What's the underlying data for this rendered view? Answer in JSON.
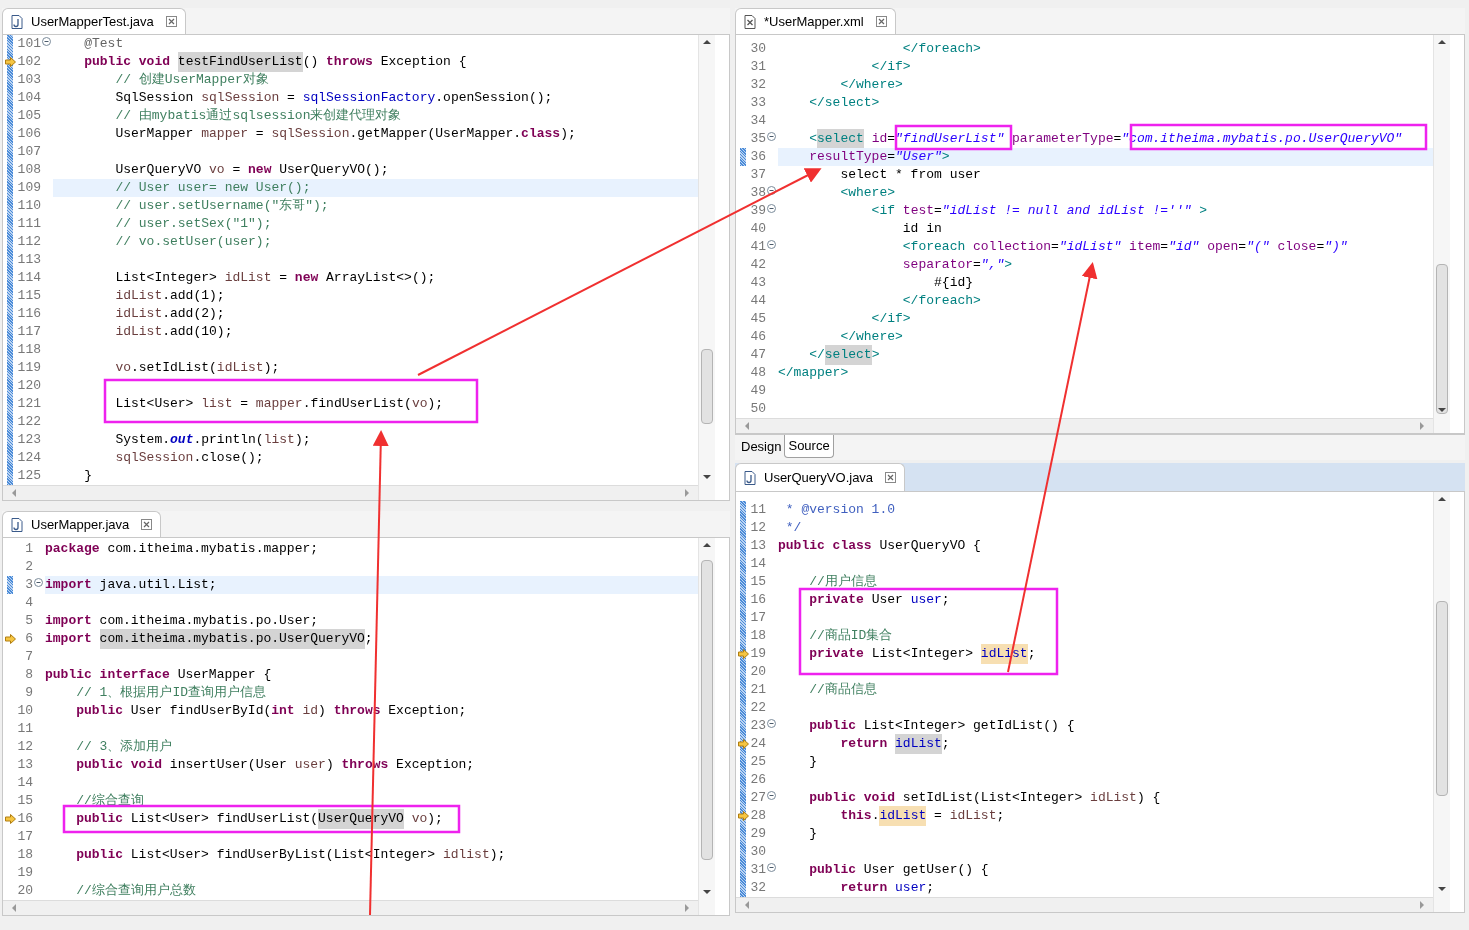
{
  "panes": [
    {
      "tab": {
        "title": "UserMapperTest.java",
        "kind": "java"
      },
      "ruler": true,
      "lines": [
        {
          "n": "101",
          "kind": "fold",
          "current": false,
          "spans": [
            {
              "text": "    @Test",
              "kind": "ann"
            }
          ]
        },
        {
          "n": "102",
          "kind": "arrow",
          "current": false,
          "spans": [
            {
              "text": "    public void ",
              "kind": "kw"
            },
            {
              "text": "testFindUserList",
              "kind": "occ"
            },
            {
              "text": "() ",
              "kind": "p"
            },
            {
              "text": "throws",
              "kind": "kw"
            },
            {
              "text": " Exception {",
              "kind": "p"
            }
          ]
        },
        {
          "n": "103",
          "kind": "plain",
          "current": false,
          "spans": [
            {
              "text": "        // 创建UserMapper对象",
              "kind": "cm"
            }
          ]
        },
        {
          "n": "104",
          "kind": "plain",
          "current": false,
          "spans": [
            {
              "text": "        SqlSession ",
              "kind": "p"
            },
            {
              "text": "sqlSession",
              "kind": "var"
            },
            {
              "text": " = ",
              "kind": "p"
            },
            {
              "text": "sqlSessionFactory",
              "kind": "fld"
            },
            {
              "text": ".openSession();",
              "kind": "p"
            }
          ]
        },
        {
          "n": "105",
          "kind": "plain",
          "current": false,
          "spans": [
            {
              "text": "        // 由mybatis通过sqlsession来创建代理对象",
              "kind": "cm"
            }
          ]
        },
        {
          "n": "106",
          "kind": "plain",
          "current": false,
          "spans": [
            {
              "text": "        UserMapper ",
              "kind": "p"
            },
            {
              "text": "mapper",
              "kind": "var"
            },
            {
              "text": " = ",
              "kind": "p"
            },
            {
              "text": "sqlSession",
              "kind": "var"
            },
            {
              "text": ".getMapper(UserMapper.",
              "kind": "p"
            },
            {
              "text": "class",
              "kind": "kw"
            },
            {
              "text": ");",
              "kind": "p"
            }
          ]
        },
        {
          "n": "107",
          "kind": "plain",
          "current": false
        },
        {
          "n": "108",
          "kind": "plain",
          "current": false,
          "spans": [
            {
              "text": "        UserQueryVO ",
              "kind": "p"
            },
            {
              "text": "vo",
              "kind": "var"
            },
            {
              "text": " = ",
              "kind": "p"
            },
            {
              "text": "new",
              "kind": "kw"
            },
            {
              "text": " UserQueryVO();",
              "kind": "p"
            }
          ]
        },
        {
          "n": "109",
          "kind": "plain",
          "current": true,
          "spans": [
            {
              "text": "        // User user= new User();",
              "kind": "cm"
            }
          ]
        },
        {
          "n": "110",
          "kind": "plain",
          "current": false,
          "spans": [
            {
              "text": "        // user.setUsername(\"东哥\");",
              "kind": "cm"
            }
          ]
        },
        {
          "n": "111",
          "kind": "plain",
          "current": false,
          "spans": [
            {
              "text": "        // user.setSex(\"1\");",
              "kind": "cm"
            }
          ]
        },
        {
          "n": "112",
          "kind": "plain",
          "current": false,
          "spans": [
            {
              "text": "        // vo.setUser(user);",
              "kind": "cm"
            }
          ]
        },
        {
          "n": "113",
          "kind": "plain",
          "current": false
        },
        {
          "n": "114",
          "kind": "plain",
          "current": false,
          "spans": [
            {
              "text": "        List<Integer> ",
              "kind": "p"
            },
            {
              "text": "idList",
              "kind": "var"
            },
            {
              "text": " = ",
              "kind": "p"
            },
            {
              "text": "new",
              "kind": "kw"
            },
            {
              "text": " ArrayList<>();",
              "kind": "p"
            }
          ]
        },
        {
          "n": "115",
          "kind": "plain",
          "current": false,
          "spans": [
            {
              "text": "        idList",
              "kind": "var"
            },
            {
              "text": ".add(1);",
              "kind": "p"
            }
          ]
        },
        {
          "n": "116",
          "kind": "plain",
          "current": false,
          "spans": [
            {
              "text": "        idList",
              "kind": "var"
            },
            {
              "text": ".add(2);",
              "kind": "p"
            }
          ]
        },
        {
          "n": "117",
          "kind": "plain",
          "current": false,
          "spans": [
            {
              "text": "        idList",
              "kind": "var"
            },
            {
              "text": ".add(10);",
              "kind": "p"
            }
          ]
        },
        {
          "n": "118",
          "kind": "plain",
          "current": false
        },
        {
          "n": "119",
          "kind": "plain",
          "current": false,
          "spans": [
            {
              "text": "        vo",
              "kind": "var"
            },
            {
              "text": ".setIdList(",
              "kind": "p"
            },
            {
              "text": "idList",
              "kind": "var"
            },
            {
              "text": ");",
              "kind": "p"
            }
          ]
        },
        {
          "n": "120",
          "kind": "plain",
          "current": false
        },
        {
          "n": "121",
          "kind": "plain",
          "current": false,
          "spans": [
            {
              "text": "        List<User> ",
              "kind": "p"
            },
            {
              "text": "list",
              "kind": "var"
            },
            {
              "text": " = ",
              "kind": "p"
            },
            {
              "text": "mapper",
              "kind": "var"
            },
            {
              "text": ".findUserList(",
              "kind": "p"
            },
            {
              "text": "vo",
              "kind": "var"
            },
            {
              "text": ");",
              "kind": "p"
            }
          ]
        },
        {
          "n": "122",
          "kind": "plain",
          "current": false
        },
        {
          "n": "123",
          "kind": "plain",
          "current": false,
          "spans": [
            {
              "text": "        System.",
              "kind": "p"
            },
            {
              "text": "out",
              "kind": "sfld"
            },
            {
              "text": ".println(",
              "kind": "p"
            },
            {
              "text": "list",
              "kind": "var"
            },
            {
              "text": ");",
              "kind": "p"
            }
          ]
        },
        {
          "n": "124",
          "kind": "plain",
          "current": false,
          "spans": [
            {
              "text": "        sqlSession",
              "kind": "var"
            },
            {
              "text": ".close();",
              "kind": "p"
            }
          ]
        },
        {
          "n": "125",
          "kind": "plain",
          "current": false,
          "spans": [
            {
              "text": "    }",
              "kind": "p"
            }
          ]
        }
      ]
    },
    {
      "tab": {
        "title": "*UserMapper.xml",
        "kind": "xml"
      },
      "ruler": false,
      "lines": [
        {
          "n": "30",
          "kind": "plain",
          "current": false,
          "spans": [
            {
              "text": "                </foreach>",
              "kind": "tag"
            }
          ]
        },
        {
          "n": "31",
          "kind": "plain",
          "current": false,
          "spans": [
            {
              "text": "            </if>",
              "kind": "tag"
            }
          ]
        },
        {
          "n": "32",
          "kind": "plain",
          "current": false,
          "spans": [
            {
              "text": "        </where>",
              "kind": "tag"
            }
          ]
        },
        {
          "n": "33",
          "kind": "plain",
          "current": false,
          "spans": [
            {
              "text": "    </select>",
              "kind": "tag"
            }
          ]
        },
        {
          "n": "34",
          "kind": "plain",
          "current": false
        },
        {
          "n": "35",
          "kind": "fold",
          "current": false,
          "spans": [
            {
              "text": "    <",
              "kind": "tag"
            },
            {
              "text": "select",
              "kind": "tagocc"
            },
            {
              "text": " id",
              "kind": "attr"
            },
            {
              "text": "=",
              "kind": "p"
            },
            {
              "text": "\"findUserList\"",
              "kind": "str"
            },
            {
              "text": " parameterType",
              "kind": "attr"
            },
            {
              "text": "=",
              "kind": "p"
            },
            {
              "text": "\"com.itheima.mybatis.po.UserQueryVO\"",
              "kind": "str"
            }
          ]
        },
        {
          "n": "36",
          "kind": "plain",
          "current": true,
          "spans": [
            {
              "text": "    resultType",
              "kind": "attr"
            },
            {
              "text": "=",
              "kind": "p"
            },
            {
              "text": "\"User\"",
              "kind": "str"
            },
            {
              "text": ">",
              "kind": "tag"
            }
          ]
        },
        {
          "n": "37",
          "kind": "plain",
          "current": false,
          "spans": [
            {
              "text": "        select * from user",
              "kind": "p"
            }
          ]
        },
        {
          "n": "38",
          "kind": "fold",
          "current": false,
          "spans": [
            {
              "text": "        <where>",
              "kind": "tag"
            }
          ]
        },
        {
          "n": "39",
          "kind": "fold",
          "current": false,
          "spans": [
            {
              "text": "            <if ",
              "kind": "tag"
            },
            {
              "text": "test",
              "kind": "attr"
            },
            {
              "text": "=",
              "kind": "p"
            },
            {
              "text": "\"idList != null and idList !=''\"",
              "kind": "str"
            },
            {
              "text": " >",
              "kind": "tag"
            }
          ]
        },
        {
          "n": "40",
          "kind": "plain",
          "current": false,
          "spans": [
            {
              "text": "                id in",
              "kind": "p"
            }
          ]
        },
        {
          "n": "41",
          "kind": "fold",
          "current": false,
          "spans": [
            {
              "text": "                <foreach ",
              "kind": "tag"
            },
            {
              "text": "collection",
              "kind": "attr"
            },
            {
              "text": "=",
              "kind": "p"
            },
            {
              "text": "\"idList\"",
              "kind": "str"
            },
            {
              "text": " item",
              "kind": "attr"
            },
            {
              "text": "=",
              "kind": "p"
            },
            {
              "text": "\"id\"",
              "kind": "str"
            },
            {
              "text": " open",
              "kind": "attr"
            },
            {
              "text": "=",
              "kind": "p"
            },
            {
              "text": "\"(\"",
              "kind": "str"
            },
            {
              "text": " close",
              "kind": "attr"
            },
            {
              "text": "=",
              "kind": "p"
            },
            {
              "text": "\")\"",
              "kind": "str"
            }
          ]
        },
        {
          "n": "42",
          "kind": "plain",
          "current": false,
          "spans": [
            {
              "text": "                separator",
              "kind": "attr"
            },
            {
              "text": "=",
              "kind": "p"
            },
            {
              "text": "\",\"",
              "kind": "str"
            },
            {
              "text": ">",
              "kind": "tag"
            }
          ]
        },
        {
          "n": "43",
          "kind": "plain",
          "current": false,
          "spans": [
            {
              "text": "                    #{id}",
              "kind": "p"
            }
          ]
        },
        {
          "n": "44",
          "kind": "plain",
          "current": false,
          "spans": [
            {
              "text": "                </foreach>",
              "kind": "tag"
            }
          ]
        },
        {
          "n": "45",
          "kind": "plain",
          "current": false,
          "spans": [
            {
              "text": "            </if>",
              "kind": "tag"
            }
          ]
        },
        {
          "n": "46",
          "kind": "plain",
          "current": false,
          "spans": [
            {
              "text": "        </where>",
              "kind": "tag"
            }
          ]
        },
        {
          "n": "47",
          "kind": "plain",
          "current": false,
          "spans": [
            {
              "text": "    </",
              "kind": "tag"
            },
            {
              "text": "select",
              "kind": "tagocc"
            },
            {
              "text": ">",
              "kind": "tag"
            }
          ]
        },
        {
          "n": "48",
          "kind": "plain",
          "current": false,
          "spans": [
            {
              "text": "</mapper>",
              "kind": "tag"
            }
          ]
        },
        {
          "n": "49",
          "kind": "plain",
          "current": false
        },
        {
          "n": "50",
          "kind": "plain",
          "current": false
        }
      ],
      "bottom_tabs": [
        {
          "label": "Design",
          "selected": false
        },
        {
          "label": "Source",
          "selected": true
        }
      ]
    },
    {
      "tab": {
        "title": "UserMapper.java",
        "kind": "java"
      },
      "ruler": false,
      "lines": [
        {
          "n": "1",
          "kind": "plain",
          "current": false,
          "spans": [
            {
              "text": "package",
              "kind": "kw"
            },
            {
              "text": " com.itheima.mybatis.mapper;",
              "kind": "p"
            }
          ]
        },
        {
          "n": "2",
          "kind": "plain",
          "current": false
        },
        {
          "n": "3",
          "kind": "fold",
          "current": true,
          "spans": [
            {
              "text": "import",
              "kind": "kw"
            },
            {
              "text": " java.util.List;",
              "kind": "p"
            }
          ]
        },
        {
          "n": "4",
          "kind": "plain",
          "current": false
        },
        {
          "n": "5",
          "kind": "plain",
          "current": false,
          "spans": [
            {
              "text": "import",
              "kind": "kw"
            },
            {
              "text": " com.itheima.mybatis.po.User;",
              "kind": "p"
            }
          ]
        },
        {
          "n": "6",
          "kind": "arrow",
          "current": false,
          "spans": [
            {
              "text": "import ",
              "kind": "kw"
            },
            {
              "text": "com.itheima.mybatis.po.UserQueryVO",
              "kind": "occ"
            },
            {
              "text": ";",
              "kind": "p"
            }
          ]
        },
        {
          "n": "7",
          "kind": "plain",
          "current": false
        },
        {
          "n": "8",
          "kind": "plain",
          "current": false,
          "spans": [
            {
              "text": "public interface",
              "kind": "kw"
            },
            {
              "text": " UserMapper {",
              "kind": "p"
            }
          ]
        },
        {
          "n": "9",
          "kind": "plain",
          "current": false,
          "spans": [
            {
              "text": "    // 1、根据用户ID查询用户信息",
              "kind": "cm"
            }
          ]
        },
        {
          "n": "10",
          "kind": "plain",
          "current": false,
          "spans": [
            {
              "text": "    public",
              "kind": "kw"
            },
            {
              "text": " User findUserById(",
              "kind": "p"
            },
            {
              "text": "int",
              "kind": "kw"
            },
            {
              "text": " id",
              "kind": "var"
            },
            {
              "text": ") ",
              "kind": "p"
            },
            {
              "text": "throws",
              "kind": "kw"
            },
            {
              "text": " Exception;",
              "kind": "p"
            }
          ]
        },
        {
          "n": "11",
          "kind": "plain",
          "current": false
        },
        {
          "n": "12",
          "kind": "plain",
          "current": false,
          "spans": [
            {
              "text": "    // 3、添加用户",
              "kind": "cm"
            }
          ]
        },
        {
          "n": "13",
          "kind": "plain",
          "current": false,
          "spans": [
            {
              "text": "    public void",
              "kind": "kw"
            },
            {
              "text": " insertUser(User ",
              "kind": "p"
            },
            {
              "text": "user",
              "kind": "var"
            },
            {
              "text": ") ",
              "kind": "p"
            },
            {
              "text": "throws",
              "kind": "kw"
            },
            {
              "text": " Exception;",
              "kind": "p"
            }
          ]
        },
        {
          "n": "14",
          "kind": "plain",
          "current": false
        },
        {
          "n": "15",
          "kind": "plain",
          "current": false,
          "spans": [
            {
              "text": "    //综合查询",
              "kind": "cm"
            }
          ]
        },
        {
          "n": "16",
          "kind": "arrow",
          "current": false,
          "spans": [
            {
              "text": "    public",
              "kind": "kw"
            },
            {
              "text": " List<User> findUserList(",
              "kind": "p"
            },
            {
              "text": "UserQueryVO",
              "kind": "occ"
            },
            {
              "text": " vo",
              "kind": "var"
            },
            {
              "text": ");",
              "kind": "p"
            }
          ]
        },
        {
          "n": "17",
          "kind": "plain",
          "current": false
        },
        {
          "n": "18",
          "kind": "plain",
          "current": false,
          "spans": [
            {
              "text": "    public",
              "kind": "kw"
            },
            {
              "text": " List<User> findUserByList(List<Integer> ",
              "kind": "p"
            },
            {
              "text": "idlist",
              "kind": "var"
            },
            {
              "text": ");",
              "kind": "p"
            }
          ]
        },
        {
          "n": "19",
          "kind": "plain",
          "current": false
        },
        {
          "n": "20",
          "kind": "plain",
          "current": false,
          "spans": [
            {
              "text": "    //综合查询用户总数",
              "kind": "cm"
            }
          ]
        }
      ]
    },
    {
      "tab": {
        "title": "UserQueryVO.java",
        "kind": "java"
      },
      "ruler": true,
      "lines": [
        {
          "n": "11",
          "kind": "plain",
          "current": false,
          "spans": [
            {
              "text": " * @version 1.0",
              "kind": "doc"
            }
          ]
        },
        {
          "n": "12",
          "kind": "plain",
          "current": false,
          "spans": [
            {
              "text": " */",
              "kind": "doc"
            }
          ]
        },
        {
          "n": "13",
          "kind": "plain",
          "current": false,
          "spans": [
            {
              "text": "public class",
              "kind": "kw"
            },
            {
              "text": " UserQueryVO {",
              "kind": "p"
            }
          ]
        },
        {
          "n": "14",
          "kind": "plain",
          "current": false
        },
        {
          "n": "15",
          "kind": "plain",
          "current": false,
          "spans": [
            {
              "text": "    //用户信息",
              "kind": "cm"
            }
          ]
        },
        {
          "n": "16",
          "kind": "plain",
          "current": false,
          "spans": [
            {
              "text": "    private",
              "kind": "kw"
            },
            {
              "text": " User ",
              "kind": "p"
            },
            {
              "text": "user",
              "kind": "fld"
            },
            {
              "text": ";",
              "kind": "p"
            }
          ]
        },
        {
          "n": "17",
          "kind": "plain",
          "current": false
        },
        {
          "n": "18",
          "kind": "plain",
          "current": false,
          "spans": [
            {
              "text": "    //商品ID集合",
              "kind": "cm"
            }
          ]
        },
        {
          "n": "19",
          "kind": "arrow",
          "current": false,
          "spans": [
            {
              "text": "    private",
              "kind": "kw"
            },
            {
              "text": " List<Integer> ",
              "kind": "p"
            },
            {
              "text": "idList",
              "kind": "fldwrite"
            },
            {
              "text": ";",
              "kind": "p"
            }
          ]
        },
        {
          "n": "20",
          "kind": "plain",
          "current": false
        },
        {
          "n": "21",
          "kind": "plain",
          "current": false,
          "spans": [
            {
              "text": "    //商品信息",
              "kind": "cm"
            }
          ]
        },
        {
          "n": "22",
          "kind": "plain",
          "current": false
        },
        {
          "n": "23",
          "kind": "fold",
          "current": false,
          "spans": [
            {
              "text": "    public",
              "kind": "kw"
            },
            {
              "text": " List<Integer> getIdList() {",
              "kind": "p"
            }
          ]
        },
        {
          "n": "24",
          "kind": "arrow",
          "current": false,
          "spans": [
            {
              "text": "        return ",
              "kind": "kw"
            },
            {
              "text": "idList",
              "kind": "fldocc"
            },
            {
              "text": ";",
              "kind": "p"
            }
          ]
        },
        {
          "n": "25",
          "kind": "plain",
          "current": false,
          "spans": [
            {
              "text": "    }",
              "kind": "p"
            }
          ]
        },
        {
          "n": "26",
          "kind": "plain",
          "current": false
        },
        {
          "n": "27",
          "kind": "fold",
          "current": false,
          "spans": [
            {
              "text": "    public void",
              "kind": "kw"
            },
            {
              "text": " setIdList(List<Integer> ",
              "kind": "p"
            },
            {
              "text": "idList",
              "kind": "var"
            },
            {
              "text": ") {",
              "kind": "p"
            }
          ]
        },
        {
          "n": "28",
          "kind": "arrow",
          "current": false,
          "spans": [
            {
              "text": "        this",
              "kind": "kw"
            },
            {
              "text": ".",
              "kind": "p"
            },
            {
              "text": "idList",
              "kind": "fldwrite"
            },
            {
              "text": " = ",
              "kind": "p"
            },
            {
              "text": "idList",
              "kind": "var"
            },
            {
              "text": ";",
              "kind": "p"
            }
          ]
        },
        {
          "n": "29",
          "kind": "plain",
          "current": false,
          "spans": [
            {
              "text": "    }",
              "kind": "p"
            }
          ]
        },
        {
          "n": "30",
          "kind": "plain",
          "current": false
        },
        {
          "n": "31",
          "kind": "fold",
          "current": false,
          "spans": [
            {
              "text": "    public",
              "kind": "kw"
            },
            {
              "text": " User getUser() {",
              "kind": "p"
            }
          ]
        },
        {
          "n": "32",
          "kind": "plain",
          "current": false,
          "spans": [
            {
              "text": "        return ",
              "kind": "kw"
            },
            {
              "text": "user",
              "kind": "fld"
            },
            {
              "text": ";",
              "kind": "p"
            }
          ]
        }
      ]
    }
  ]
}
